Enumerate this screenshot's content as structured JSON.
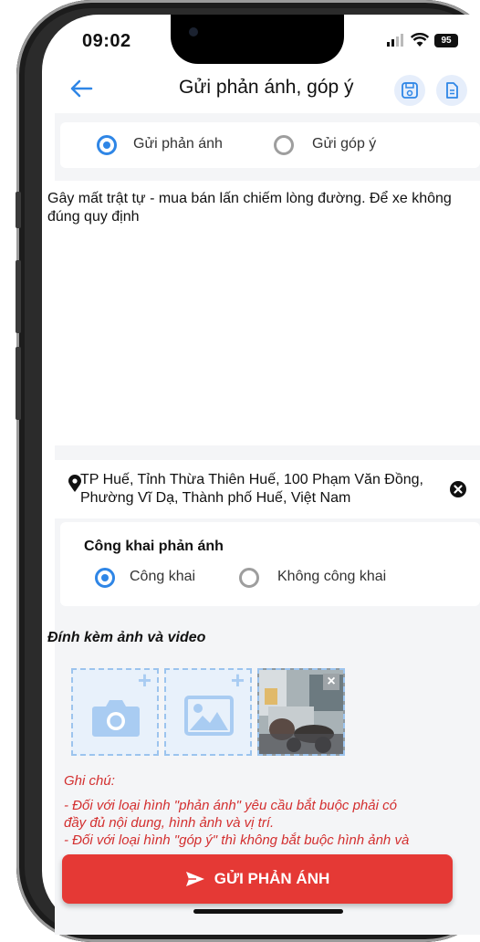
{
  "status_bar": {
    "time": "09:02",
    "battery": "95"
  },
  "header": {
    "title": "Gửi phản ánh, góp ý"
  },
  "type_selector": {
    "options": [
      {
        "label": "Gửi phản ánh",
        "selected": true
      },
      {
        "label": "Gửi góp ý",
        "selected": false
      }
    ]
  },
  "description": {
    "value": "Gây mất trật tự - mua bán lấn chiếm lòng đường. Để xe không đúng quy định"
  },
  "location": {
    "address": "TP Huế, Tỉnh Thừa Thiên Huế, 100 Phạm Văn Đồng, Phường Vĩ Dạ, Thành phố Huế, Việt Nam"
  },
  "publicity": {
    "title": "Công khai phản ánh",
    "options": [
      {
        "label": "Công khai",
        "selected": true
      },
      {
        "label": "Không công khai",
        "selected": false
      }
    ]
  },
  "attachments": {
    "title": "Đính kèm ảnh và video",
    "plus": "+",
    "remove": "×"
  },
  "note": {
    "title": "Ghi chú:",
    "lines": [
      "- Đối với loại hình \"phản ánh\" yêu cầu bắt buộc phải có",
      "đầy đủ nội dung, hình ảnh và vị trí.",
      "- Đối với loại hình \"góp ý\" thì không bắt buộc hình ảnh và"
    ]
  },
  "submit": {
    "label": "GỬI PHẢN ÁNH"
  },
  "colors": {
    "accent": "#2f86e6",
    "danger": "#e53935",
    "note": "#d32f2f"
  }
}
